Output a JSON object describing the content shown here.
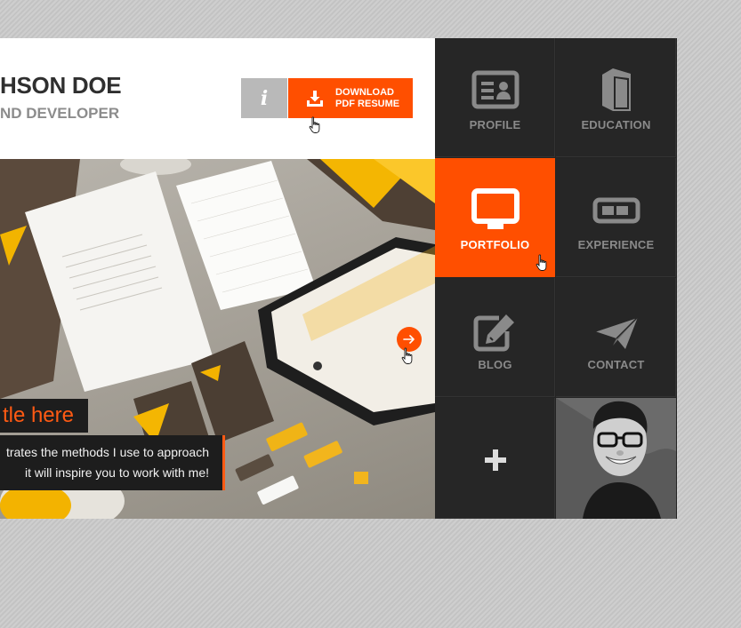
{
  "header": {
    "name": "HSON DOE",
    "role": "ND DEVELOPER",
    "info_label": "i",
    "download": {
      "line1": "DOWNLOAD",
      "line2": "PDF RESUME",
      "icon": "download-icon"
    }
  },
  "hero": {
    "title": "tle here",
    "description": [
      "trates the methods I use to approach",
      "it will inspire you to work with me!"
    ],
    "next_icon": "arrow-right-icon"
  },
  "tiles": [
    {
      "label": "PROFILE",
      "icon": "id-card-icon"
    },
    {
      "label": "EDUCATION",
      "icon": "book-icon"
    },
    {
      "label": "PORTFOLIO",
      "icon": "monitor-icon",
      "active": true
    },
    {
      "label": "EXPERIENCE",
      "icon": "battery-icon"
    },
    {
      "label": "BLOG",
      "icon": "edit-icon"
    },
    {
      "label": "CONTACT",
      "icon": "paper-plane-icon"
    },
    {
      "label": "",
      "icon": "plus-icon"
    },
    {
      "label": "",
      "icon": "avatar-photo"
    }
  ],
  "colors": {
    "accent": "#ff4f00",
    "tile_bg": "#262626",
    "tile_text": "#8a8a8a",
    "header_bg": "#ffffff"
  }
}
